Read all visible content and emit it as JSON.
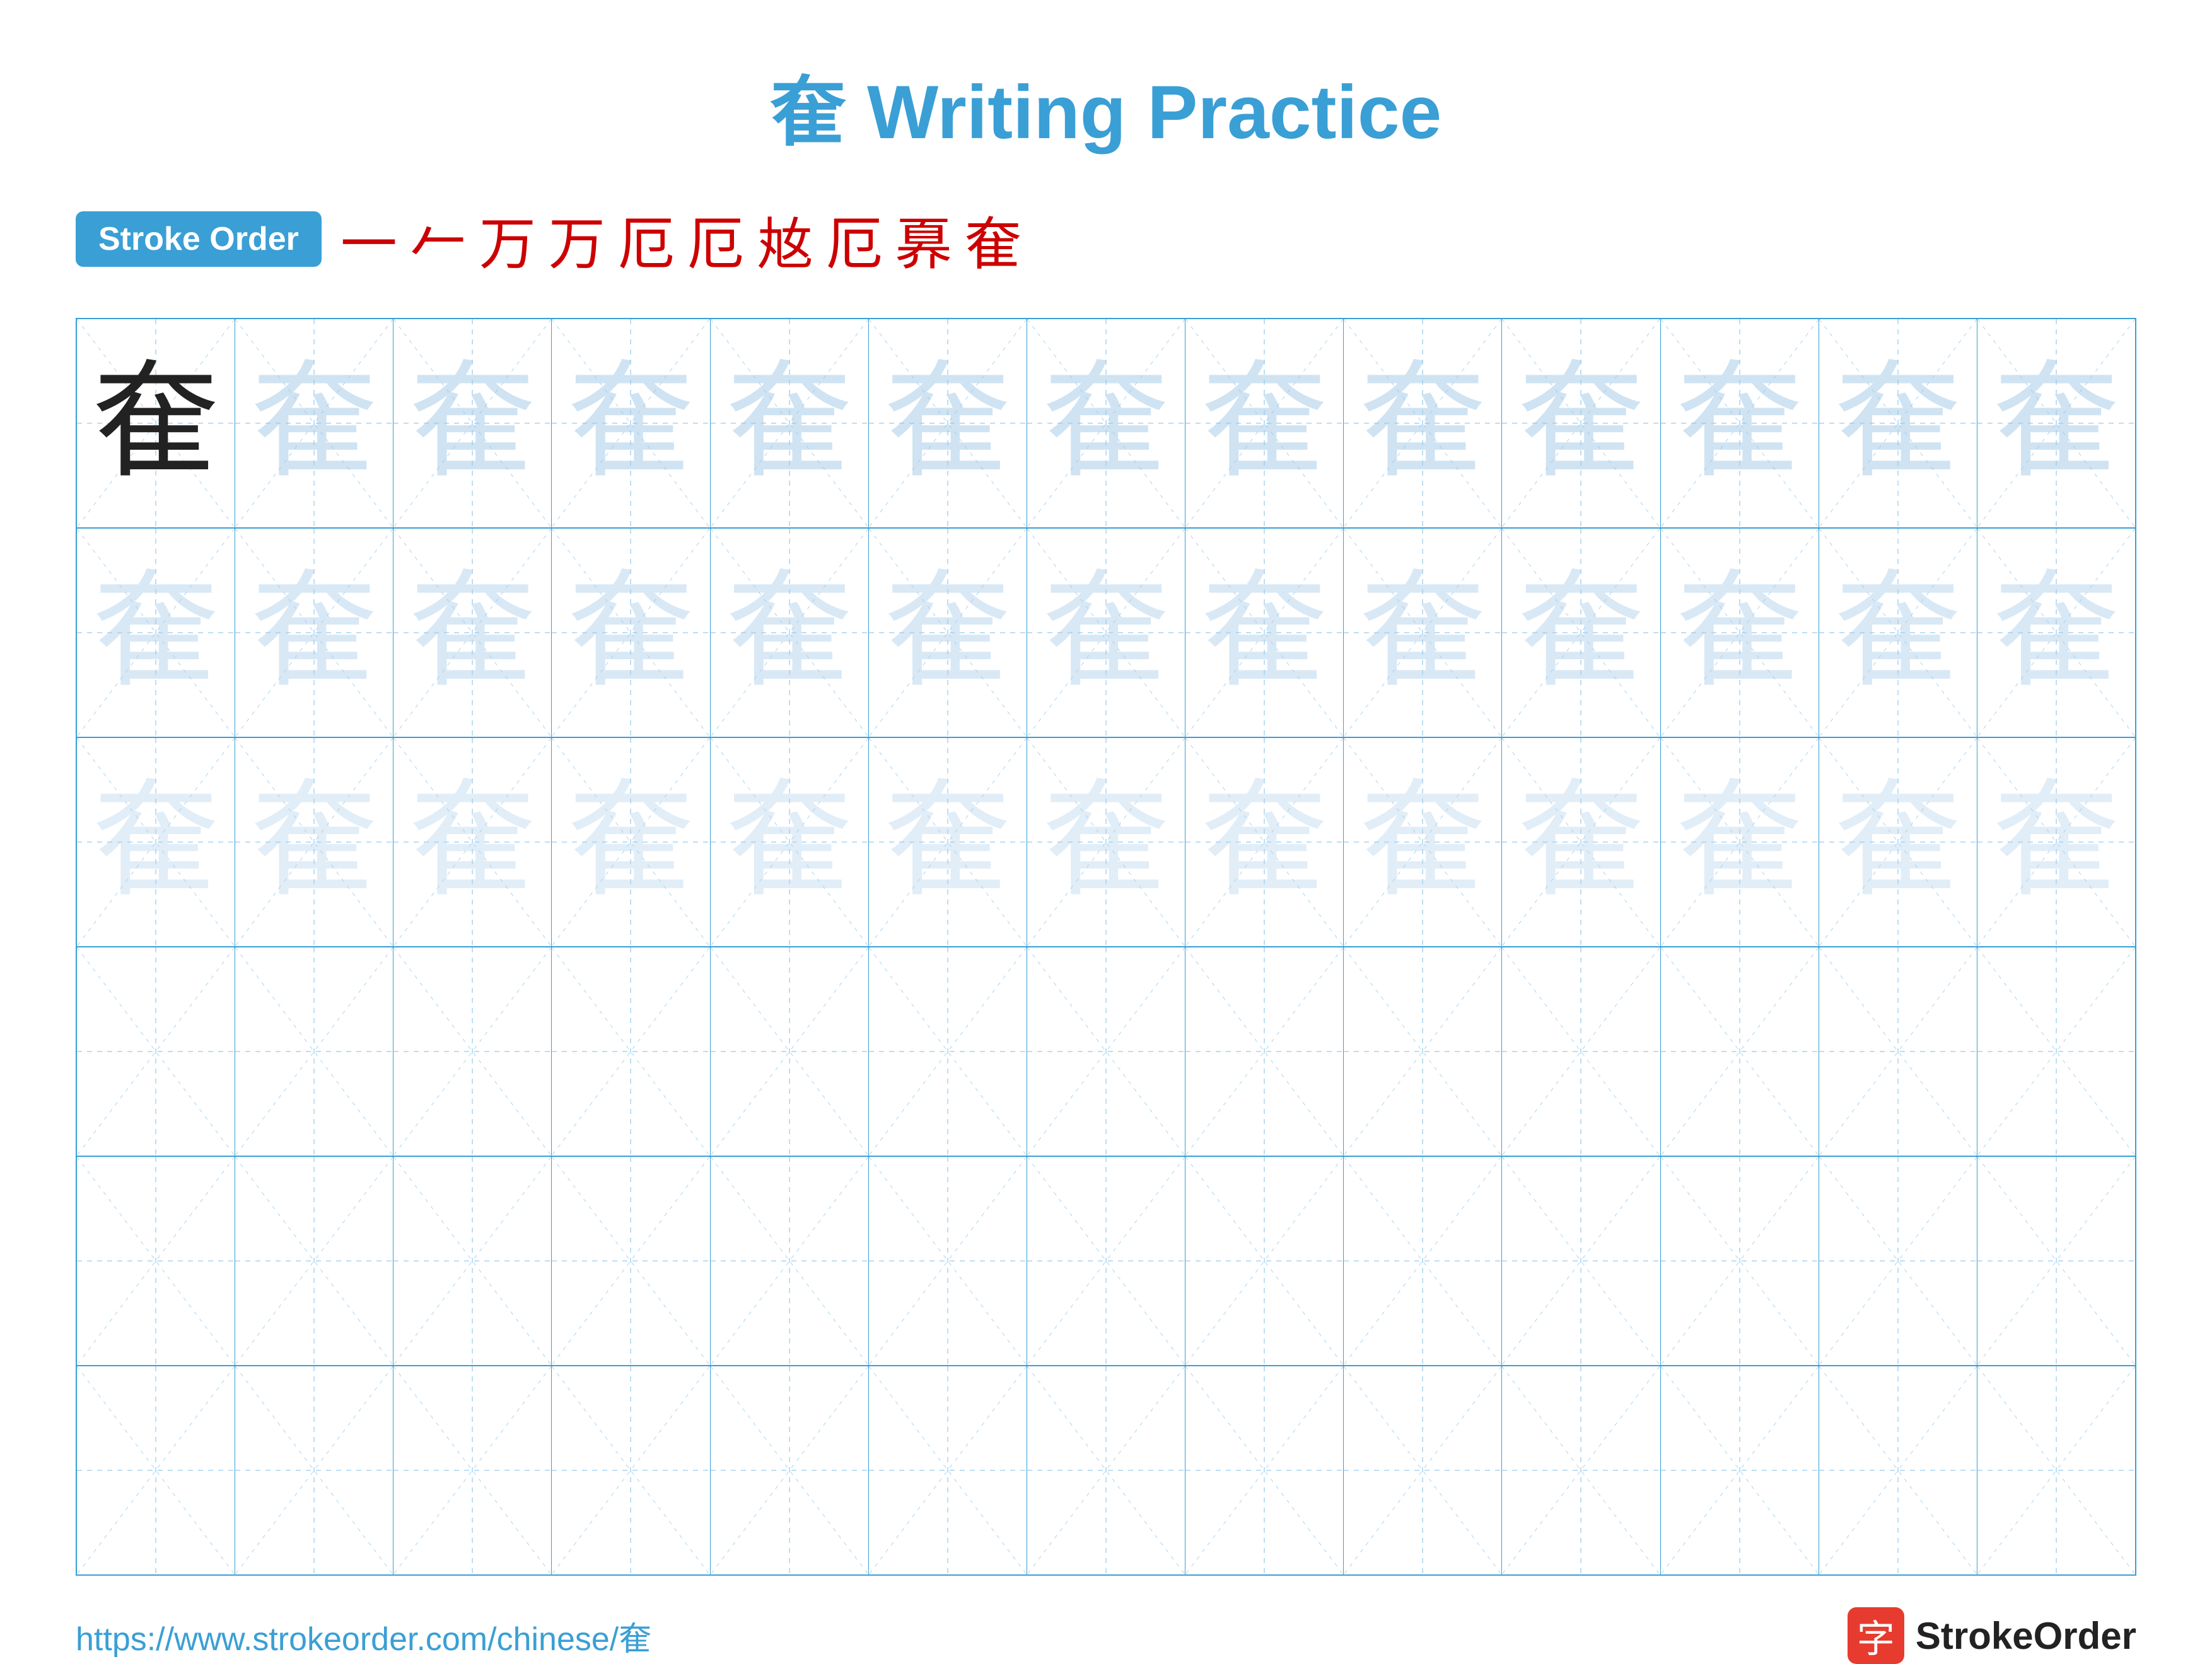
{
  "title": {
    "char": "奞",
    "label": "Writing Practice"
  },
  "stroke_order": {
    "badge_label": "Stroke Order",
    "strokes": [
      "一",
      "𠂉",
      "万",
      "万",
      "厄",
      "厄",
      "奿",
      "厄",
      "奡",
      "奞"
    ]
  },
  "grid": {
    "rows": 6,
    "cols": 13,
    "char": "奞",
    "char_rows_with_ghost": 3
  },
  "footer": {
    "url": "https://www.strokeorder.com/chinese/奞",
    "logo_char": "字",
    "logo_text": "StrokeOrder"
  },
  "colors": {
    "accent": "#3a9fd5",
    "red": "#cc0000",
    "ghost": "rgba(180,210,235,0.55)",
    "solid": "#222"
  }
}
